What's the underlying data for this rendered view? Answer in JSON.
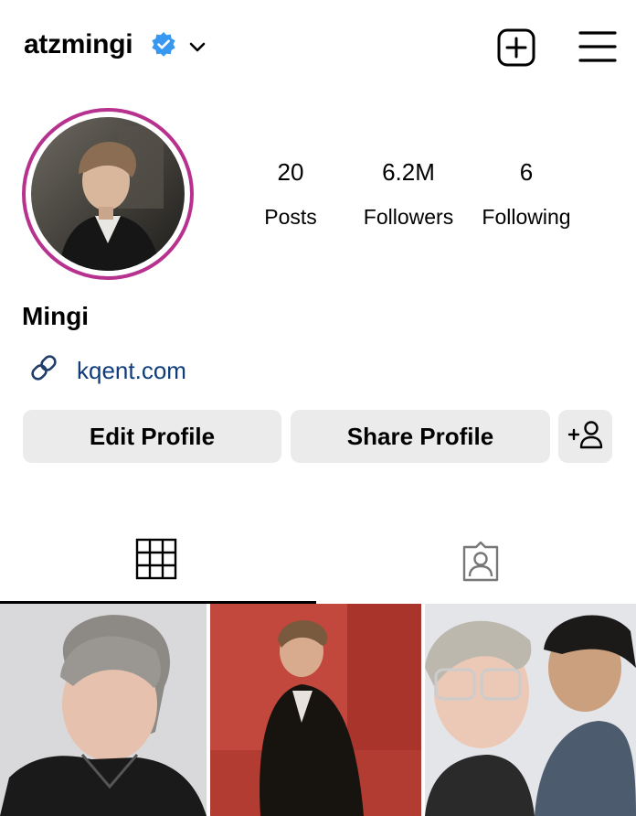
{
  "header": {
    "username": "atzmingi",
    "verified_icon": "verified-badge-icon",
    "dropdown_icon": "chevron-down-icon",
    "new_post_icon": "plus-square-icon",
    "menu_icon": "hamburger-menu-icon"
  },
  "stats": {
    "posts": {
      "value": "20",
      "label": "Posts"
    },
    "followers": {
      "value": "6.2M",
      "label": "Followers"
    },
    "following": {
      "value": "6",
      "label": "Following"
    }
  },
  "profile": {
    "display_name": "Mingi",
    "link_icon": "link-icon",
    "link_text": "kqent.com",
    "ring_color": "#b7318f",
    "link_color": "#0f3c7a",
    "verified_color": "#3897f0"
  },
  "buttons": {
    "edit_label": "Edit Profile",
    "share_label": "Share Profile",
    "add_person_icon": "add-person-icon"
  },
  "tabs": {
    "grid_icon": "grid-icon",
    "tagged_icon": "tagged-person-icon",
    "active": "grid"
  },
  "posts": [
    "photo",
    "photo",
    "photo"
  ]
}
